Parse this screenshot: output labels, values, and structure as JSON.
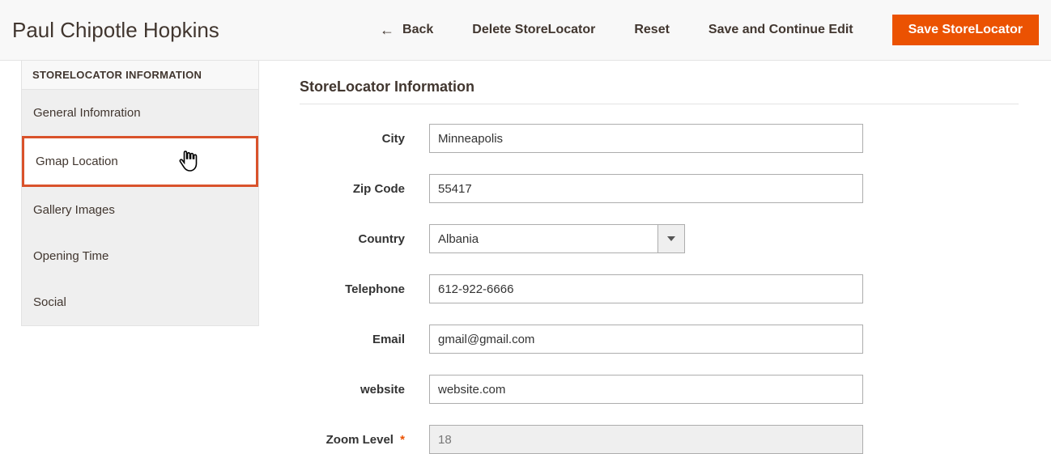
{
  "header": {
    "title": "Paul Chipotle Hopkins",
    "actions": {
      "back": "Back",
      "delete": "Delete StoreLocator",
      "reset": "Reset",
      "save_continue": "Save and Continue Edit",
      "save": "Save StoreLocator"
    }
  },
  "sidebar": {
    "panel_title": "STORELOCATOR INFORMATION",
    "tabs": [
      {
        "label": "General Infomration"
      },
      {
        "label": "Gmap Location"
      },
      {
        "label": "Gallery Images"
      },
      {
        "label": "Opening Time"
      },
      {
        "label": "Social"
      }
    ]
  },
  "main": {
    "section_title": "StoreLocator Information",
    "fields": {
      "city": {
        "label": "City",
        "value": "Minneapolis"
      },
      "zip": {
        "label": "Zip Code",
        "value": "55417"
      },
      "country": {
        "label": "Country",
        "value": "Albania"
      },
      "telephone": {
        "label": "Telephone",
        "value": "612-922-6666"
      },
      "email": {
        "label": "Email",
        "value": "gmail@gmail.com"
      },
      "website": {
        "label": "website",
        "value": "website.com"
      },
      "zoom": {
        "label": "Zoom Level",
        "value": "18",
        "required": true,
        "readonly": true
      }
    }
  }
}
